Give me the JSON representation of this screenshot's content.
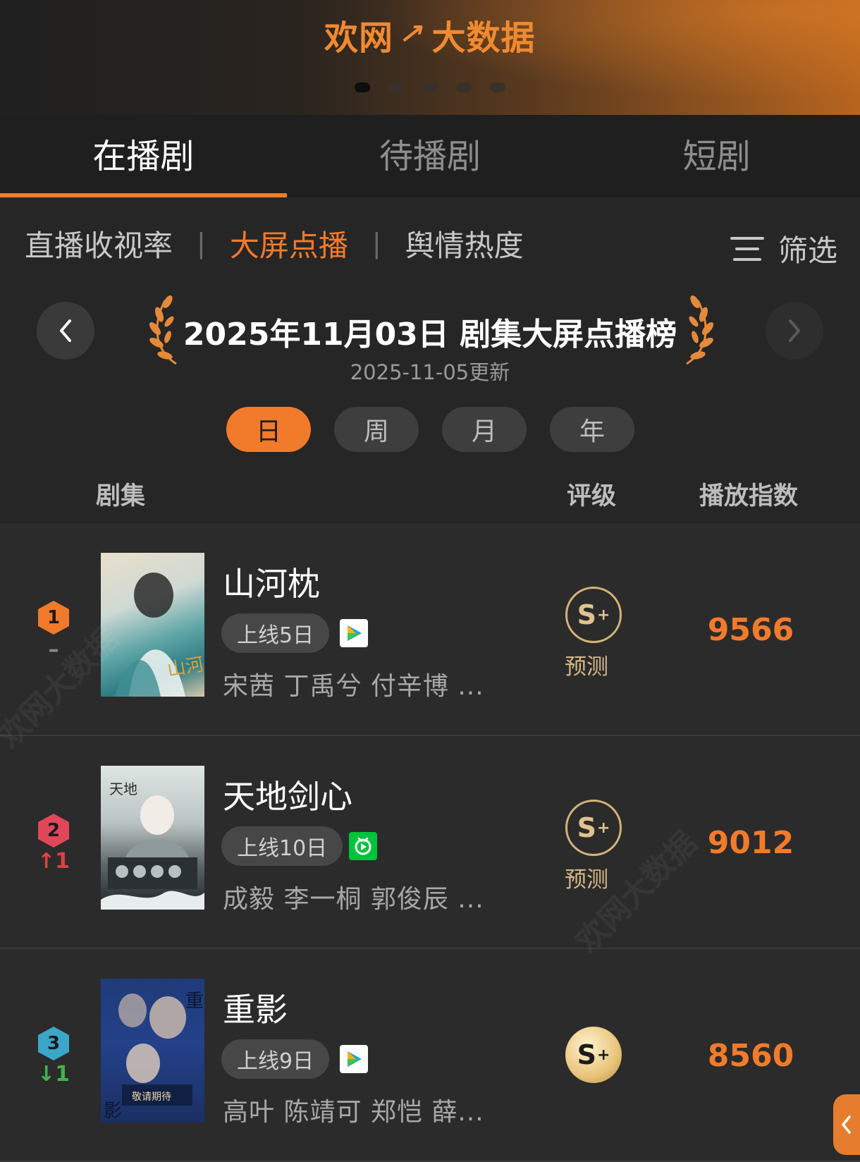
{
  "banner": {
    "brand_text": "欢网",
    "brand_sub": "大数据",
    "carousel_count": 5,
    "carousel_active": 0
  },
  "main_tabs": [
    {
      "label": "在播剧",
      "active": true
    },
    {
      "label": "待播剧",
      "active": false
    },
    {
      "label": "短剧",
      "active": false
    }
  ],
  "sub_tabs": [
    {
      "label": "直播收视率",
      "active": false
    },
    {
      "label": "大屏点播",
      "active": true
    },
    {
      "label": "舆情热度",
      "active": false
    }
  ],
  "filter_label": "筛选",
  "ranking": {
    "title": "2025年11月03日 剧集大屏点播榜",
    "updated": "2025-11-05更新"
  },
  "periods": [
    {
      "label": "日",
      "active": true
    },
    {
      "label": "周",
      "active": false
    },
    {
      "label": "月",
      "active": false
    },
    {
      "label": "年",
      "active": false
    }
  ],
  "columns": {
    "drama": "剧集",
    "rating": "评级",
    "index": "播放指数"
  },
  "rows": [
    {
      "rank": "1",
      "change": "–",
      "change_dir": "none",
      "title": "山河枕",
      "days": "上线5日",
      "platform": "tencent-video-icon",
      "cast": "宋茜 丁禹兮 付辛博 ...",
      "grade": "S",
      "grade_plus": "+",
      "grade_label": "预测",
      "grade_filled": false,
      "index": "9566"
    },
    {
      "rank": "2",
      "change": "↑1",
      "change_dir": "up",
      "title": "天地剑心",
      "days": "上线10日",
      "platform": "iqiyi-icon",
      "cast": "成毅 李一桐 郭俊辰 ...",
      "grade": "S",
      "grade_plus": "+",
      "grade_label": "预测",
      "grade_filled": false,
      "index": "9012"
    },
    {
      "rank": "3",
      "change": "↓1",
      "change_dir": "down",
      "title": "重影",
      "days": "上线9日",
      "platform": "tencent-video-icon",
      "cast": "高叶 陈靖可 郑恺 薛...",
      "grade": "S",
      "grade_plus": "+",
      "grade_label": "",
      "grade_filled": true,
      "index": "8560"
    }
  ],
  "watermark": "欢网大数据",
  "colors": {
    "accent": "#f27b2b",
    "rank1": "#f07a2a",
    "rank2": "#e0475a",
    "rank3": "#3aa6c8",
    "up": "#e04040",
    "down": "#3cb54a",
    "iqiyi": "#00c43c"
  }
}
